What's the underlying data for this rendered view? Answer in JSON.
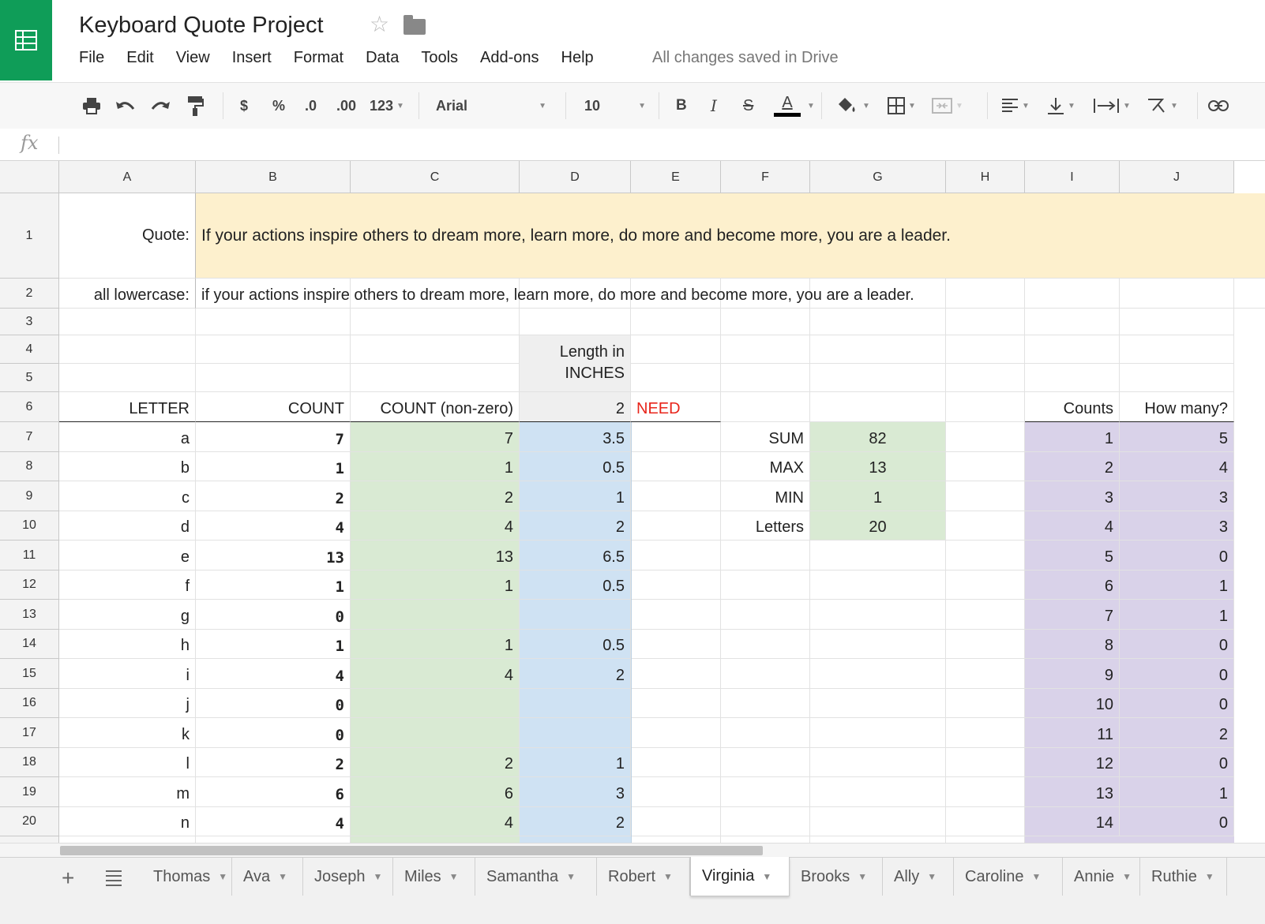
{
  "document": {
    "title": "Keyboard Quote Project",
    "save_status": "All changes saved in Drive"
  },
  "menu": [
    "File",
    "Edit",
    "View",
    "Insert",
    "Format",
    "Data",
    "Tools",
    "Add-ons",
    "Help"
  ],
  "toolbar": {
    "currency": "$",
    "percent": "%",
    "dec_decrease": ".0",
    "dec_increase": ".00",
    "more_formats": "123",
    "font": "Arial",
    "font_size": "10",
    "bold": "B",
    "italic": "I",
    "strike": "S",
    "text_color": "A"
  },
  "formula_bar": {
    "label": "fx",
    "value": ""
  },
  "columns": [
    {
      "label": "A",
      "width": 173
    },
    {
      "label": "B",
      "width": 196
    },
    {
      "label": "C",
      "width": 214
    },
    {
      "label": "D",
      "width": 141
    },
    {
      "label": "E",
      "width": 114
    },
    {
      "label": "F",
      "width": 113
    },
    {
      "label": "G",
      "width": 172
    },
    {
      "label": "H",
      "width": 100
    },
    {
      "label": "I",
      "width": 120
    },
    {
      "label": "J",
      "width": 145
    }
  ],
  "rows": [
    {
      "label": "1",
      "height": 108
    },
    {
      "label": "2",
      "height": 38
    },
    {
      "label": "3",
      "height": 34
    },
    {
      "label": "4",
      "height": 36
    },
    {
      "label": "5",
      "height": 36
    },
    {
      "label": "6",
      "height": 38
    },
    {
      "label": "7",
      "height": 38
    },
    {
      "label": "8",
      "height": 37
    },
    {
      "label": "9",
      "height": 38
    },
    {
      "label": "10",
      "height": 37
    },
    {
      "label": "11",
      "height": 38
    },
    {
      "label": "12",
      "height": 37
    },
    {
      "label": "13",
      "height": 38
    },
    {
      "label": "14",
      "height": 37
    },
    {
      "label": "15",
      "height": 38
    },
    {
      "label": "16",
      "height": 37
    },
    {
      "label": "17",
      "height": 38
    },
    {
      "label": "18",
      "height": 37
    },
    {
      "label": "19",
      "height": 38
    },
    {
      "label": "20",
      "height": 37
    },
    {
      "label": "",
      "height": 10
    }
  ],
  "colors": {
    "quote_fill": "#fdf0cd",
    "green_fill": "#d9ead3",
    "blue_fill": "#cfe2f3",
    "purple_fill": "#d9d2e9",
    "need_red": "#e8251b",
    "header_fill": "#efefef",
    "brand_green": "#0f9d58"
  },
  "quote": {
    "label": "Quote:",
    "text": "If your actions inspire others to dream more, learn more, do more and become more, you are a leader."
  },
  "lowercase": {
    "label": "all lowercase:",
    "text": "if your actions inspire others to dream more, learn more, do more and become more, you are a leader."
  },
  "headers": {
    "letter": "LETTER",
    "count": "COUNT",
    "count_nonzero": "COUNT (non-zero)",
    "length_line1": "Length in",
    "length_line2": "INCHES",
    "length_value": "2",
    "need": "NEED",
    "counts": "Counts",
    "how_many": "How many?"
  },
  "letters": [
    {
      "letter": "a",
      "count": "7",
      "nonzero": "7",
      "length": "3.5"
    },
    {
      "letter": "b",
      "count": "1",
      "nonzero": "1",
      "length": "0.5"
    },
    {
      "letter": "c",
      "count": "2",
      "nonzero": "2",
      "length": "1"
    },
    {
      "letter": "d",
      "count": "4",
      "nonzero": "4",
      "length": "2"
    },
    {
      "letter": "e",
      "count": "13",
      "nonzero": "13",
      "length": "6.5"
    },
    {
      "letter": "f",
      "count": "1",
      "nonzero": "1",
      "length": "0.5"
    },
    {
      "letter": "g",
      "count": "0",
      "nonzero": "",
      "length": ""
    },
    {
      "letter": "h",
      "count": "1",
      "nonzero": "1",
      "length": "0.5"
    },
    {
      "letter": "i",
      "count": "4",
      "nonzero": "4",
      "length": "2"
    },
    {
      "letter": "j",
      "count": "0",
      "nonzero": "",
      "length": ""
    },
    {
      "letter": "k",
      "count": "0",
      "nonzero": "",
      "length": ""
    },
    {
      "letter": "l",
      "count": "2",
      "nonzero": "2",
      "length": "1"
    },
    {
      "letter": "m",
      "count": "6",
      "nonzero": "6",
      "length": "3"
    },
    {
      "letter": "n",
      "count": "4",
      "nonzero": "4",
      "length": "2"
    }
  ],
  "stats": [
    {
      "label": "SUM",
      "value": "82"
    },
    {
      "label": "MAX",
      "value": "13"
    },
    {
      "label": "MIN",
      "value": "1"
    },
    {
      "label": "Letters",
      "value": "20"
    }
  ],
  "distribution": [
    {
      "count": "1",
      "how_many": "5"
    },
    {
      "count": "2",
      "how_many": "4"
    },
    {
      "count": "3",
      "how_many": "3"
    },
    {
      "count": "4",
      "how_many": "3"
    },
    {
      "count": "5",
      "how_many": "0"
    },
    {
      "count": "6",
      "how_many": "1"
    },
    {
      "count": "7",
      "how_many": "1"
    },
    {
      "count": "8",
      "how_many": "0"
    },
    {
      "count": "9",
      "how_many": "0"
    },
    {
      "count": "10",
      "how_many": "0"
    },
    {
      "count": "11",
      "how_many": "2"
    },
    {
      "count": "12",
      "how_many": "0"
    },
    {
      "count": "13",
      "how_many": "1"
    },
    {
      "count": "14",
      "how_many": "0"
    }
  ],
  "sheets": [
    {
      "name": "Thomas",
      "width": 114
    },
    {
      "name": "Ava",
      "width": 90
    },
    {
      "name": "Joseph",
      "width": 114
    },
    {
      "name": "Miles",
      "width": 104
    },
    {
      "name": "Samantha",
      "width": 154
    },
    {
      "name": "Robert",
      "width": 118
    },
    {
      "name": "Virginia",
      "width": 126,
      "active": true
    },
    {
      "name": "Brooks",
      "width": 118
    },
    {
      "name": "Ally",
      "width": 90
    },
    {
      "name": "Caroline",
      "width": 138
    },
    {
      "name": "Annie",
      "width": 98
    },
    {
      "name": "Ruthie",
      "width": 110
    }
  ]
}
